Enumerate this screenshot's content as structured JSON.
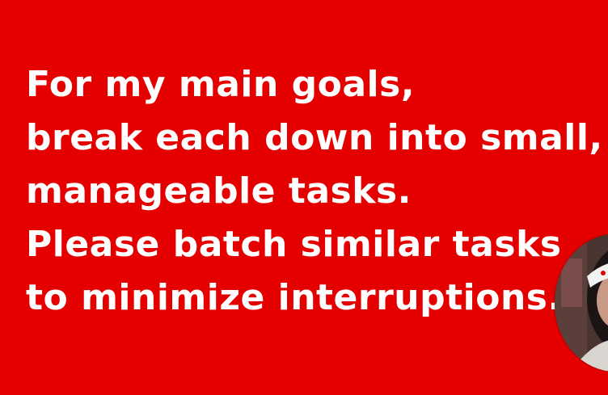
{
  "slide": {
    "background_color": "#e50000",
    "text_color": "#ffffff",
    "lines": [
      "For my main goals,",
      "break each down into small,",
      "manageable tasks.",
      "Please batch similar tasks",
      "to minimize interruptions."
    ]
  },
  "presenter": {
    "icon": "person-avatar-icon"
  }
}
